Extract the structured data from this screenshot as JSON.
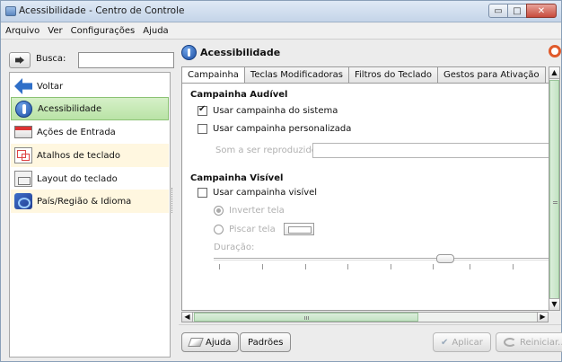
{
  "window": {
    "title": "Acessibilidade - Centro de Controle",
    "controls": [
      "minimize",
      "maximize",
      "close"
    ]
  },
  "menubar": {
    "items": [
      {
        "label": "Arquivo"
      },
      {
        "label": "Ver"
      },
      {
        "label": "Configurações"
      },
      {
        "label": "Ajuda"
      }
    ]
  },
  "search": {
    "label": "Busca:",
    "value": ""
  },
  "sidebar": {
    "items": [
      {
        "label": "Voltar",
        "icon": "back-arrow-icon"
      },
      {
        "label": "Acessibilidade",
        "icon": "accessibility-icon",
        "selected": true
      },
      {
        "label": "Ações de Entrada",
        "icon": "keyboard-icon"
      },
      {
        "label": "Atalhos de teclado",
        "icon": "shortcut-icon"
      },
      {
        "label": "Layout do teclado",
        "icon": "keyboard-layout-icon"
      },
      {
        "label": "País/Região & Idioma",
        "icon": "flag-icon"
      }
    ]
  },
  "page": {
    "title": "Acessibilidade",
    "tabs": [
      {
        "label": "Campainha",
        "active": true
      },
      {
        "label": "Teclas Modificadoras"
      },
      {
        "label": "Filtros do Teclado"
      },
      {
        "label": "Gestos para Ativação"
      }
    ]
  },
  "bell": {
    "audible_group": "Campainha Audível",
    "use_system_bell": "Usar campainha do sistema",
    "use_system_bell_checked": true,
    "use_custom_bell": "Usar campainha personalizada",
    "use_custom_bell_checked": false,
    "sound_label": "Som a ser reproduzido:",
    "sound_value": "",
    "visible_group": "Campainha Visível",
    "use_visible_bell": "Usar campainha visível",
    "use_visible_bell_checked": false,
    "invert_screen": "Inverter tela",
    "flash_screen": "Piscar tela",
    "duration_label": "Duração:",
    "duration_level": 0.68
  },
  "buttons": {
    "help": "Ajuda",
    "defaults": "Padrões",
    "apply": "Aplicar",
    "reset": "Reiniciar..."
  },
  "colors": {
    "selection_green": "#b9e3a6",
    "titlebar_blue": "#c4d4e8",
    "close_red": "#c74b3c"
  }
}
